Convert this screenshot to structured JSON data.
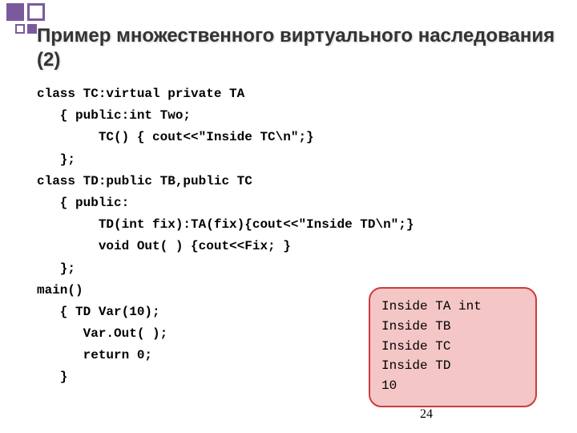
{
  "title": "Пример множественного виртуального наследования (2)",
  "code": "class TC:virtual private TA\n   { public:int Two;\n        TC() { cout<<\"Inside TC\\n\";}\n   };\nclass TD:public TB,public TC\n   { public:\n        TD(int fix):TA(fix){cout<<\"Inside TD\\n\";}\n        void Out( ) {cout<<Fix; }\n   };\nmain()\n   { TD Var(10);\n      Var.Out( );\n      return 0;\n   }",
  "output": {
    "line1": "Inside TA int",
    "line2": "Inside TB",
    "line3": "Inside TC",
    "line4": "Inside TD",
    "line5": "10"
  },
  "page_number": "24"
}
